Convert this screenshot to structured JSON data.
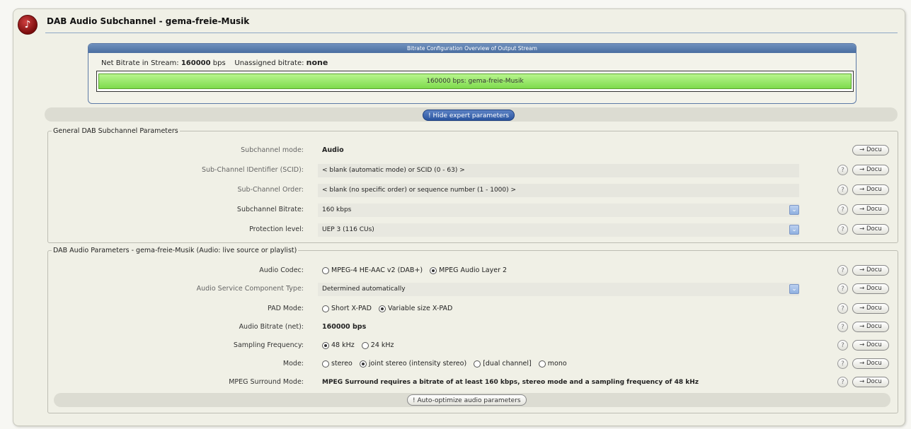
{
  "header": {
    "title": "DAB Audio Subchannel - gema-freie-Musik",
    "logo_icon": "app-logo-icon"
  },
  "overview": {
    "heading": "Bitrate Configuration Overview of Output Stream",
    "net_label": "Net Bitrate in Stream:",
    "net_value": "160000",
    "net_unit": "bps",
    "unassigned_label": "Unassigned bitrate:",
    "unassigned_value": "none",
    "bar_label": "160000 bps: gema-freie-Musik",
    "bar_fill": 1.0
  },
  "expert_button": "! Hide expert parameters",
  "general": {
    "legend": "General DAB Subchannel Parameters",
    "rows": [
      {
        "label": "Subchannel mode:",
        "value": "Audio"
      },
      {
        "label": "Sub-Channel IDentifier (SCID):",
        "value": "< blank (automatic mode) or SCID (0 - 63) >"
      },
      {
        "label": "Sub-Channel Order:",
        "value": "< blank (no specific order) or sequence number (1 - 1000) >"
      },
      {
        "label": "Subchannel Bitrate:",
        "value": "160 kbps"
      },
      {
        "label": "Protection level:",
        "value": "UEP 3 (116 CUs)"
      }
    ]
  },
  "audio": {
    "legend": "DAB Audio Parameters - gema-freie-Musik (Audio: live source or playlist)",
    "codec_label": "Audio Codec:",
    "codec_options": [
      "MPEG-4 HE-AAC v2 (DAB+)",
      "MPEG Audio Layer 2"
    ],
    "asct_label": "Audio Service Component Type:",
    "asct_value": "Determined automatically",
    "pad_label": "PAD Mode:",
    "pad_options": [
      "Short X-PAD",
      "Variable size X-PAD"
    ],
    "bitrate_label": "Audio Bitrate (net):",
    "bitrate_value": "160000 bps",
    "sampling_label": "Sampling Frequency:",
    "sampling_options": [
      "48 kHz",
      "24 kHz"
    ],
    "mode_label": "Mode:",
    "mode_options": [
      "stereo",
      "joint stereo (intensity stereo)",
      "[dual channel]",
      "mono"
    ],
    "surround_label": "MPEG Surround Mode:",
    "surround_value": "MPEG Surround requires a bitrate of at least 160 kbps, stereo mode and a sampling frequency of 48 kHz",
    "auto_button": "! Auto-optimize audio parameters"
  },
  "common": {
    "docu": "→ Docu",
    "help": "?",
    "dropdown": "⌄"
  }
}
